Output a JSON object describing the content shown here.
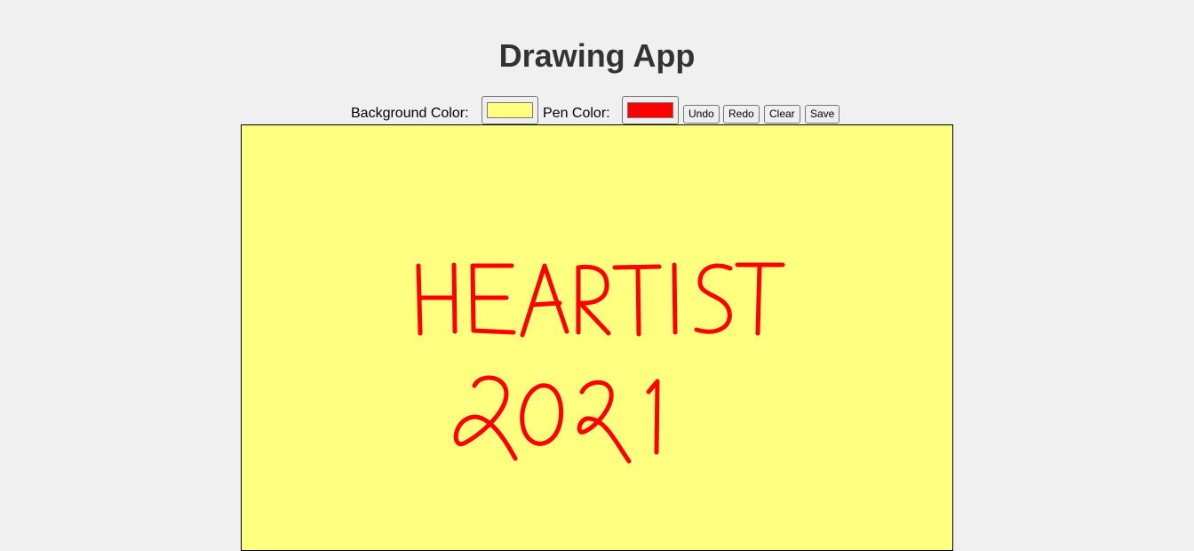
{
  "app": {
    "title": "Drawing App"
  },
  "toolbar": {
    "background_label": "Background Color:",
    "background_color": "#ffff80",
    "pen_label": "Pen Color:",
    "pen_color": "#ff0000",
    "undo_label": "Undo",
    "redo_label": "Redo",
    "clear_label": "Clear",
    "save_label": "Save"
  }
}
